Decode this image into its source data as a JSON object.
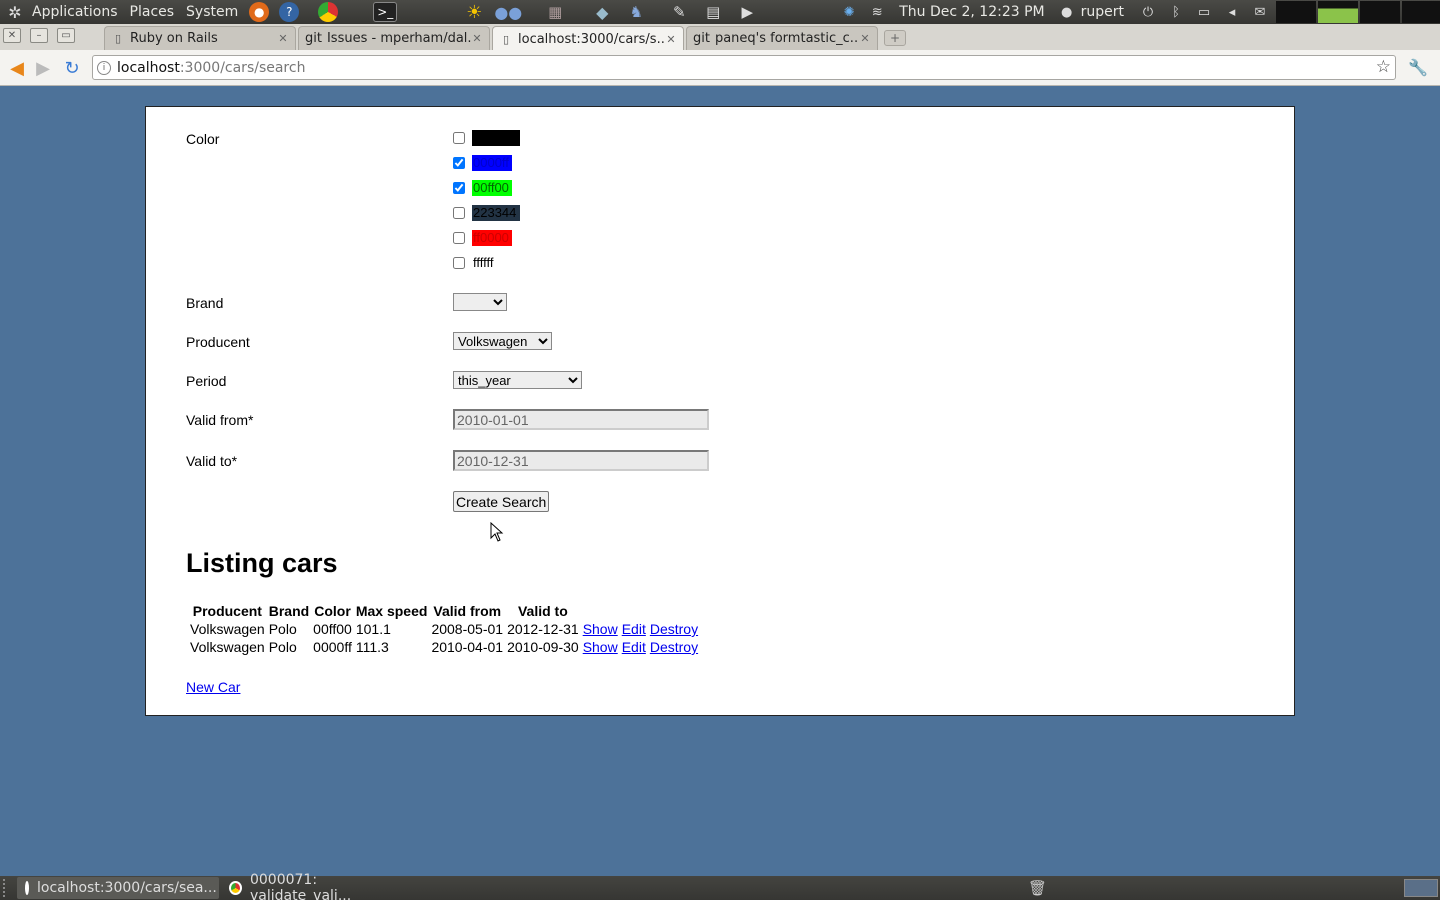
{
  "panel": {
    "menus": [
      "Applications",
      "Places",
      "System"
    ],
    "clock": "Thu Dec  2, 12:23 PM",
    "user": "rupert"
  },
  "browser": {
    "tabs": [
      {
        "label": "Ruby on Rails",
        "icon": "page-icon"
      },
      {
        "label": "Issues - mperham/dal...",
        "icon": "github-icon",
        "prefix": "git"
      },
      {
        "label": "localhost:3000/cars/s...",
        "icon": "page-icon",
        "active": true
      },
      {
        "label": "paneq's formtastic_c...",
        "icon": "github-icon",
        "prefix": "git"
      }
    ],
    "url_host": "localhost",
    "url_path": ":3000/cars/search"
  },
  "form": {
    "color_label": "Color",
    "colors": [
      {
        "hex": "000000",
        "text": "000000",
        "checked": false,
        "bg": "#000000",
        "fg": "#000000"
      },
      {
        "hex": "0000ff",
        "text": "0000ff",
        "checked": true,
        "bg": "#0000ff",
        "fg": "#0000cc"
      },
      {
        "hex": "00ff00",
        "text": "00ff00",
        "checked": true,
        "bg": "#00ff00",
        "fg": "#006600"
      },
      {
        "hex": "223344",
        "text": "223344",
        "checked": false,
        "bg": "#223344",
        "fg": "#000000"
      },
      {
        "hex": "ff0000",
        "text": "ff0000",
        "checked": false,
        "bg": "#ff0000",
        "fg": "#cc0000"
      },
      {
        "hex": "ffffff",
        "text": "ffffff",
        "checked": false,
        "bg": "#ffffff",
        "fg": "#000000"
      }
    ],
    "brand_label": "Brand",
    "brand_value": "",
    "producent_label": "Producent",
    "producent_value": "Volkswagen",
    "period_label": "Period",
    "period_value": "this_year",
    "valid_from_label": "Valid from*",
    "valid_from_value": "2010-01-01",
    "valid_to_label": "Valid to*",
    "valid_to_value": "2010-12-31",
    "submit_label": "Create Search"
  },
  "listing": {
    "title": "Listing cars",
    "headers": [
      "Producent",
      "Brand",
      "Color",
      "Max speed",
      "Valid from",
      "Valid to"
    ],
    "rows": [
      {
        "producent": "Volkswagen",
        "brand": "Polo",
        "color": "00ff00",
        "max_speed": "101.1",
        "valid_from": "2008-05-01",
        "valid_to": "2012-12-31"
      },
      {
        "producent": "Volkswagen",
        "brand": "Polo",
        "color": "0000ff",
        "max_speed": "111.3",
        "valid_from": "2010-04-01",
        "valid_to": "2010-09-30"
      }
    ],
    "show_label": "Show",
    "edit_label": "Edit",
    "destroy_label": "Destroy",
    "new_car_label": "New Car"
  },
  "taskbar": {
    "tasks": [
      "localhost:3000/cars/sea...",
      "0000071: validate_vali..."
    ]
  }
}
